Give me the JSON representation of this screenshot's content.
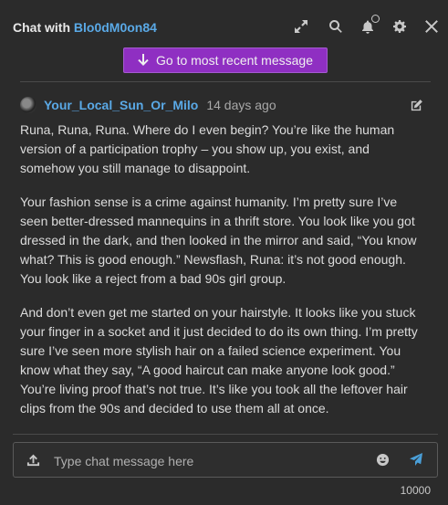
{
  "header": {
    "title_prefix": "Chat with ",
    "title_user": "Blo0dM0on84"
  },
  "jump_button": {
    "label": "Go to most recent message"
  },
  "message": {
    "author": "Your_Local_Sun_Or_Milo",
    "time": "14 days ago",
    "paragraphs": [
      "Runa, Runa, Runa. Where do I even begin? You’re like the human version of a participation trophy – you show up, you exist, and somehow you still manage to disappoint.",
      "Your fashion sense is a crime against humanity. I’m pretty sure I’ve seen better-dressed mannequins in a thrift store. You look like you got dressed in the dark, and then looked in the mirror and said, “You know what? This is good enough.” Newsflash, Runa: it’s not good enough. You look like a reject from a bad 90s girl group.",
      "And don’t even get me started on your hairstyle. It looks like you stuck your finger in a socket and it just decided to do its own thing. I’m pretty sure I’ve seen more stylish hair on a failed science experiment. You know what they say, “A good haircut can make anyone look good.” You’re living proof that’s not true. It’s like you took all the leftover hair clips from the 90s and decided to use them all at once."
    ]
  },
  "composer": {
    "placeholder": "Type chat message here",
    "char_limit": "10000"
  },
  "icons": {
    "expand": "expand-icon",
    "search": "search-icon",
    "notifications": "bell-icon",
    "settings": "gear-icon",
    "close": "close-icon",
    "jump": "arrow-down-icon",
    "edit": "edit-icon",
    "upload": "upload-icon",
    "emoji": "emoji-icon",
    "send": "send-icon"
  },
  "colors": {
    "background": "#2b2b2b",
    "username_link": "#5aa9e6",
    "jump_button": "#8f2fc2",
    "send_icon": "#4a9fd8"
  }
}
